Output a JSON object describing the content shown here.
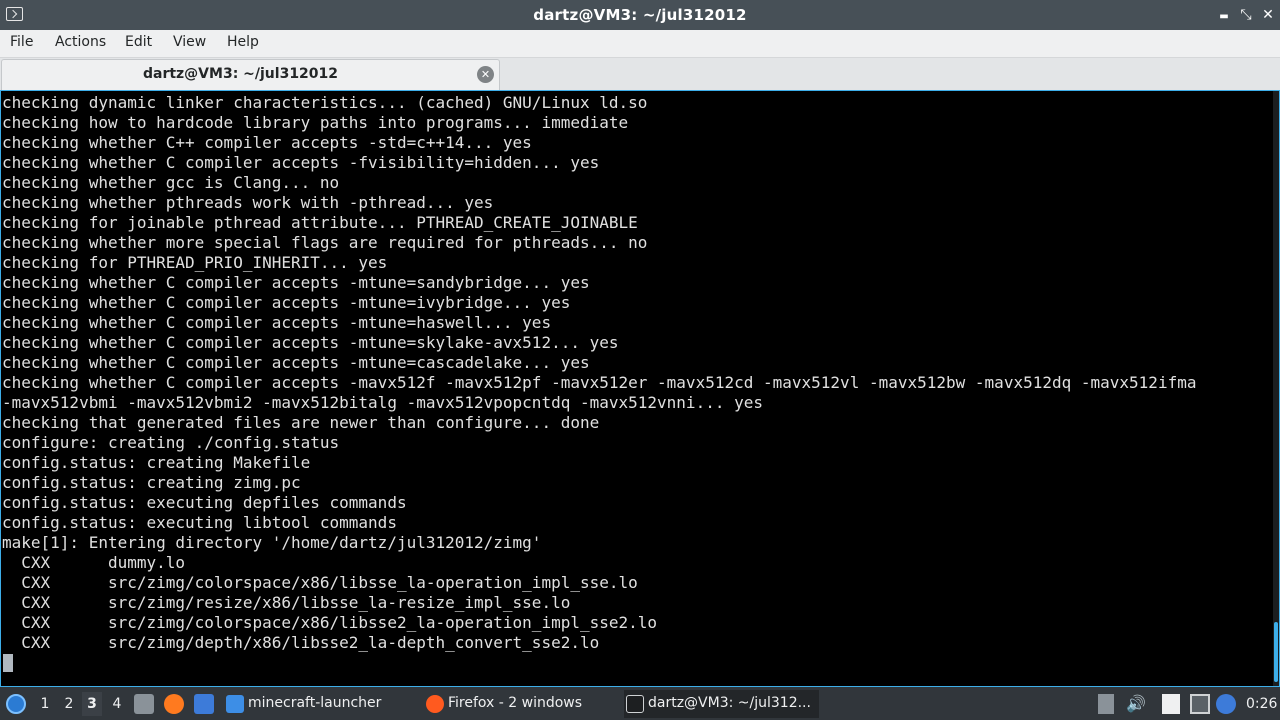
{
  "window": {
    "title": "dartz@VM3: ~/jul312012",
    "controls": {
      "minimize": "▬",
      "maximize": "⤡",
      "close": "✕"
    }
  },
  "menu": {
    "items": [
      "File",
      "Actions",
      "Edit",
      "View",
      "Help"
    ]
  },
  "tab": {
    "label": "dartz@VM3: ~/jul312012",
    "close": "✕"
  },
  "terminal": {
    "lines": [
      "checking dynamic linker characteristics... (cached) GNU/Linux ld.so",
      "checking how to hardcode library paths into programs... immediate",
      "checking whether C++ compiler accepts -std=c++14... yes",
      "checking whether C compiler accepts -fvisibility=hidden... yes",
      "checking whether gcc is Clang... no",
      "checking whether pthreads work with -pthread... yes",
      "checking for joinable pthread attribute... PTHREAD_CREATE_JOINABLE",
      "checking whether more special flags are required for pthreads... no",
      "checking for PTHREAD_PRIO_INHERIT... yes",
      "checking whether C compiler accepts -mtune=sandybridge... yes",
      "checking whether C compiler accepts -mtune=ivybridge... yes",
      "checking whether C compiler accepts -mtune=haswell... yes",
      "checking whether C compiler accepts -mtune=skylake-avx512... yes",
      "checking whether C compiler accepts -mtune=cascadelake... yes",
      "checking whether C compiler accepts -mavx512f -mavx512pf -mavx512er -mavx512cd -mavx512vl -mavx512bw -mavx512dq -mavx512ifma",
      "-mavx512vbmi -mavx512vbmi2 -mavx512bitalg -mavx512vpopcntdq -mavx512vnni... yes",
      "checking that generated files are newer than configure... done",
      "configure: creating ./config.status",
      "config.status: creating Makefile",
      "config.status: creating zimg.pc",
      "config.status: executing depfiles commands",
      "config.status: executing libtool commands",
      "make[1]: Entering directory '/home/dartz/jul312012/zimg'",
      "  CXX      dummy.lo",
      "  CXX      src/zimg/colorspace/x86/libsse_la-operation_impl_sse.lo",
      "  CXX      src/zimg/resize/x86/libsse_la-resize_impl_sse.lo",
      "  CXX      src/zimg/colorspace/x86/libsse2_la-operation_impl_sse2.lo",
      "  CXX      src/zimg/depth/x86/libsse2_la-depth_convert_sse2.lo"
    ]
  },
  "taskbar": {
    "desktops": [
      "1",
      "2",
      "3",
      "4"
    ],
    "active_desktop": "3",
    "tasks": [
      {
        "label": "minecraft-launcher",
        "icon": "folder-icon"
      },
      {
        "label": "Firefox - 2 windows",
        "icon": "firefox-icon"
      },
      {
        "label": "dartz@VM3: ~/jul312...",
        "icon": "terminal-icon"
      }
    ],
    "clock": "0:26"
  }
}
